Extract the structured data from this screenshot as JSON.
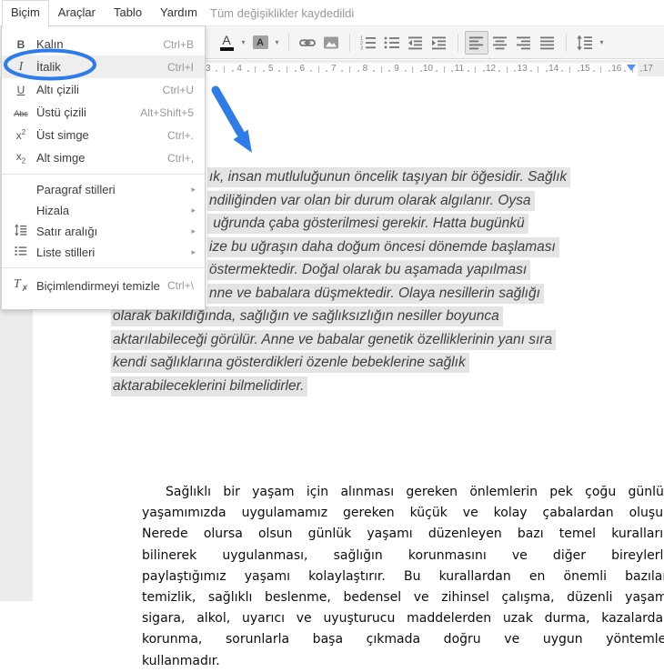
{
  "menubar": {
    "items": [
      {
        "id": "bicim",
        "label": "Biçim",
        "active": true
      },
      {
        "id": "araclar",
        "label": "Araçlar"
      },
      {
        "id": "tablo",
        "label": "Tablo"
      },
      {
        "id": "yardim",
        "label": "Yardım"
      }
    ],
    "status": "Tüm değişiklikler kaydedildi"
  },
  "format_menu": {
    "items": [
      {
        "id": "kalin",
        "icon": "bold",
        "label": "Kalın",
        "shortcut": "Ctrl+B"
      },
      {
        "id": "italik",
        "icon": "italic",
        "label": "İtalik",
        "shortcut": "Ctrl+I",
        "highlighted": true
      },
      {
        "id": "alti-cizili",
        "icon": "underline",
        "label": "Altı çizili",
        "shortcut": "Ctrl+U"
      },
      {
        "id": "ustu-cizili",
        "icon": "strikethrough",
        "label": "Üstü çizili",
        "shortcut": "Alt+Shift+5"
      },
      {
        "id": "ust-simge",
        "icon": "superscript",
        "label": "Üst simge",
        "shortcut": "Ctrl+."
      },
      {
        "id": "alt-simge",
        "icon": "subscript",
        "label": "Alt simge",
        "shortcut": "Ctrl+,"
      },
      {
        "type": "separator"
      },
      {
        "id": "paragraf-stilleri",
        "label": "Paragraf stilleri",
        "submenu": true,
        "group2": true
      },
      {
        "id": "hizala",
        "label": "Hizala",
        "submenu": true,
        "group2": true
      },
      {
        "id": "satir-araligi",
        "icon": "line-spacing",
        "label": "Satır aralığı",
        "submenu": true,
        "group2": true
      },
      {
        "id": "liste-stilleri",
        "icon": "list",
        "label": "Liste stilleri",
        "submenu": true,
        "group2": true
      },
      {
        "type": "separator"
      },
      {
        "id": "bicimlendirmeyi-temizle",
        "icon": "clear-format",
        "label": "Biçimlendirmeyi temizle",
        "shortcut": "Ctrl+\\",
        "group3": true
      }
    ]
  },
  "toolbar": {
    "items": [
      {
        "id": "text-color",
        "caret": true
      },
      {
        "id": "highlight-color",
        "caret": true
      },
      {
        "type": "separator"
      },
      {
        "id": "insert-link"
      },
      {
        "id": "insert-image"
      },
      {
        "type": "separator"
      },
      {
        "id": "numbered-list"
      },
      {
        "id": "bulleted-list"
      },
      {
        "id": "decrease-indent"
      },
      {
        "id": "increase-indent"
      },
      {
        "type": "separator"
      },
      {
        "id": "align-left",
        "active": true
      },
      {
        "id": "align-center"
      },
      {
        "id": "align-right"
      },
      {
        "id": "justify"
      },
      {
        "type": "separator"
      },
      {
        "id": "line-spacing",
        "caret": true
      }
    ]
  },
  "ruler": {
    "numbers": [
      3,
      4,
      5,
      6,
      7,
      8,
      9,
      10,
      11,
      12,
      13,
      14,
      15,
      16,
      17
    ]
  },
  "document": {
    "selected_paragraph": {
      "style": "italic, selected with gray highlight, left-aligned",
      "lines": [
        {
          "text": "ık, insan mutluluğunun öncelik taşıyan bir öğesidir. Sağlık",
          "occluded": true
        },
        {
          "text": "ndiliğinden var olan bir durum olarak algılanır. Oysa",
          "occluded": true
        },
        {
          "text": " uğrunda çaba gösterilmesi gerekir. Hatta bugünkü",
          "occluded": true
        },
        {
          "text": "ize bu uğraşın daha doğum öncesi dönemde başlaması",
          "occluded": true
        },
        {
          "text": "östermektedir. Doğal olarak bu aşamada yapılması",
          "occluded": true
        },
        {
          "text": "nne ve babalara düşmektedir. Olaya nesillerin sağlığı",
          "occluded": true
        },
        {
          "text": "olarak bakıldığında, sağlığın ve sağlıksızlığın nesiller boyunca"
        },
        {
          "text": "aktarılabileceği görülür. Anne ve babalar genetik özelliklerinin yanı sıra"
        },
        {
          "text": "kendi sağlıklarına gösterdikleri özenle bebeklerine sağlık"
        },
        {
          "text": "aktarabileceklerini bilmelidirler."
        }
      ]
    },
    "paragraph_justified": {
      "style": "justified",
      "lines": [
        "Sağlıklı bir yaşam için alınması gereken önlemlerin pek çoğu günlük",
        "yaşamımızda  uygulamamız gereken küçük ve kolay çabalardan oluşur.",
        "Nerede olursa olsun günlük yaşamı düzenleyen bazı temel kuralların",
        "bilinerek uygulanması, sağlığın korunmasını ve diğer bireylerle",
        "paylaştığımız yaşamı kolaylaştırır. Bu kurallardan en önemli bazıları",
        "temizlik, sağlıklı beslenme, bedensel ve zihinsel çalışma, düzenli yaşam,",
        "sigara, alkol, uyarıcı ve uyuşturucu maddelerden uzak durma, kazalardan",
        "korunma, sorunlarla başa çıkmada doğru ve uygun yöntemler",
        "kullanmadır."
      ]
    }
  },
  "annotations": {
    "circle_color": "#2e7cea",
    "arrow_color": "#2e7cea",
    "selection_color": "#e4e4e4"
  }
}
